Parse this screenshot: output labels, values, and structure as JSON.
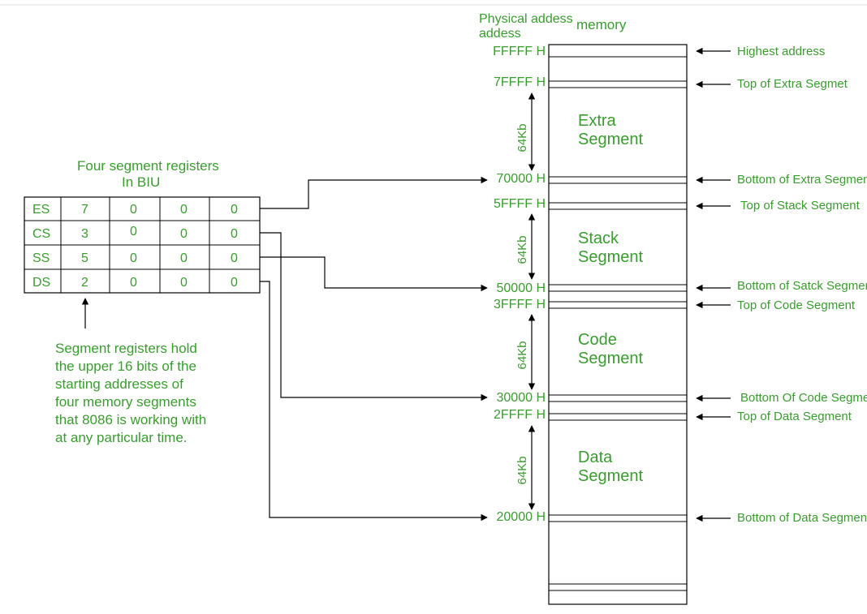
{
  "headers": {
    "physical_address": "Physical addess",
    "memory": "memory",
    "registers_title_l1": "Four segment registers",
    "registers_title_l2": "In BIU"
  },
  "registers": {
    "rows": [
      {
        "name": "ES",
        "d0": "7",
        "d1": "0",
        "d2": "0",
        "d3": "0"
      },
      {
        "name": "CS",
        "d0": "3",
        "d1": "0",
        "d2": "0",
        "d3": "0"
      },
      {
        "name": "SS",
        "d0": "5",
        "d1": "0",
        "d2": "0",
        "d3": "0"
      },
      {
        "name": "DS",
        "d0": "2",
        "d1": "0",
        "d2": "0",
        "d3": "0"
      }
    ]
  },
  "note": {
    "l1": "Segment registers hold",
    "l2": "the upper 16 bits of the",
    "l3": "starting addresses of",
    "l4": "four memory segments",
    "l5": "that 8086 is working with",
    "l6": "at any particular time."
  },
  "addresses": {
    "fffff": "FFFFF H",
    "a7ffff": "7FFFF H",
    "a70000": "70000 H",
    "a5ffff": "5FFFF H",
    "a50000": "50000 H",
    "a3ffff": "3FFFF H",
    "a30000": "30000 H",
    "a2ffff": "2FFFF H",
    "a20000": "20000 H"
  },
  "segments": {
    "extra_l1": "Extra",
    "extra_l2": "Segment",
    "stack_l1": "Stack",
    "stack_l2": "Segment",
    "code_l1": "Code",
    "code_l2": "Segment",
    "data_l1": "Data",
    "data_l2": "Segment",
    "size": "64Kb"
  },
  "labels": {
    "highest": "Highest address",
    "top_extra": "Top of Extra Segmet",
    "bottom_extra": "Bottom of Extra Segment",
    "top_stack": "Top of Stack Segment",
    "bottom_stack": "Bottom of Satck Segment",
    "top_code": "Top of Code Segment",
    "bottom_code": "Bottom Of Code Segment",
    "top_data": "Top of Data Segment",
    "bottom_data": "Bottom of Data Segment"
  }
}
